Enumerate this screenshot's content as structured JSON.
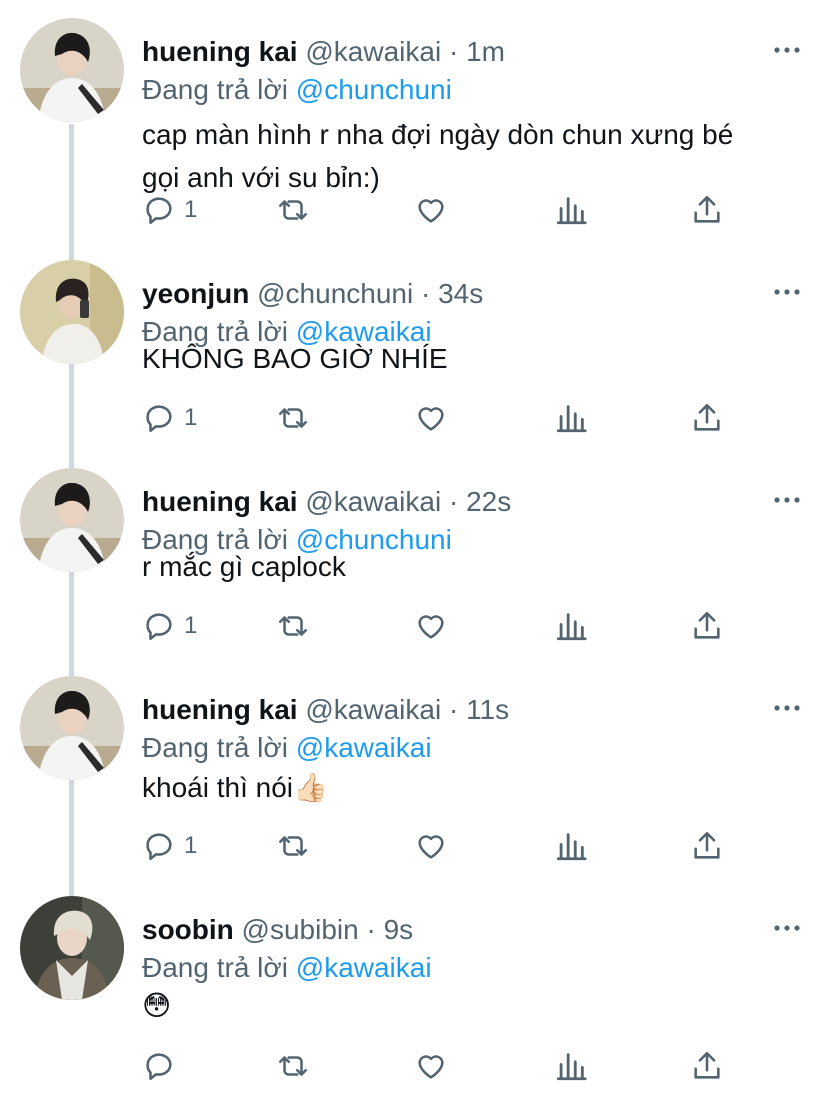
{
  "tweets": [
    {
      "name": "huening kai",
      "handle": "@kawaikai",
      "time": "1m",
      "reply_prefix": "Đang trả lời",
      "reply_to": "@chunchuni",
      "text_line1": "cap màn hình r nha đợi ngày dòn chun xưng bé",
      "text_line2": "gọi anh với su bỉn:)",
      "reply_count": "1",
      "avatar": "huening-kai-avatar"
    },
    {
      "name": "yeonjun",
      "handle": "@chunchuni",
      "time": "34s",
      "reply_prefix": "Đang trả lời",
      "reply_to": "@kawaikai",
      "text_line1": "KHÔNG BAO GIỜ NHÍE",
      "reply_count": "1",
      "avatar": "yeonjun-avatar"
    },
    {
      "name": "huening kai",
      "handle": "@kawaikai",
      "time": "22s",
      "reply_prefix": "Đang trả lời",
      "reply_to": "@chunchuni",
      "text_line1": "r mắc gì caplock",
      "reply_count": "1",
      "avatar": "huening-kai-avatar"
    },
    {
      "name": "huening kai",
      "handle": "@kawaikai",
      "time": "11s",
      "reply_prefix": "Đang trả lời",
      "reply_to": "@kawaikai",
      "text_line1": "khoái thì nói👍🏻",
      "reply_count": "1",
      "avatar": "huening-kai-avatar"
    },
    {
      "name": "soobin",
      "handle": "@subibin",
      "time": "9s",
      "reply_prefix": "Đang trả lời",
      "reply_to": "@kawaikai",
      "text_line1": "😳",
      "avatar": "soobin-avatar"
    }
  ],
  "dot": "·",
  "colors": {
    "text": "#0f1419",
    "secondary": "#536471",
    "link": "#1d9bf0",
    "thread_line": "#cfd9de"
  }
}
